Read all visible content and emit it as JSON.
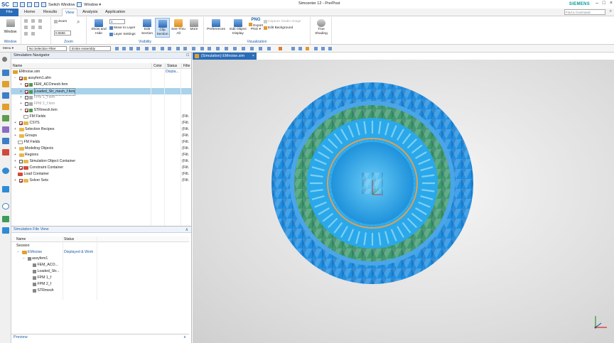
{
  "titlebar": {
    "logo": "SC",
    "switch_window": "Switch Window",
    "window_menu": "Window ▾",
    "title": "Simcenter 12 - Pre/Post",
    "brand": "SIEMENS"
  },
  "tabs": [
    {
      "label": "File"
    },
    {
      "label": "Home"
    },
    {
      "label": "Results"
    },
    {
      "label": "View"
    },
    {
      "label": "Analysis"
    },
    {
      "label": "Application"
    }
  ],
  "search_placeholder": "Find a Command",
  "ribbon": {
    "window_label": "Window",
    "zoom_label": "Zoom",
    "zoom_value": "0.5556",
    "visibility_label": "Visibility",
    "visualization_label": "Visualization",
    "layer_value": "1",
    "show_hide": "Show and Hide",
    "move_to_layer": "Move to Layer",
    "layer_settings": "Layer Settings",
    "edit_section": "Edit Section",
    "clip_section": "Clip Section",
    "see_thru_all": "See-Thru All",
    "more": "More",
    "preferences": "Preferences",
    "edit_object_display": "Edit Object Display",
    "export_png": "Export PNG ▾",
    "png": "PNG",
    "capture_studio_image": "Capture Studio Image",
    "edit_background": "Edit Background",
    "true_shading": "True Shading"
  },
  "toolbar": {
    "menu": "Menu ▾",
    "selection_filter": "No Selection Filter",
    "assembly_scope": "Entire Assembly"
  },
  "nav": {
    "title": "Simulation Navigator",
    "columns": [
      "Name",
      "Color",
      "Status",
      "Filte"
    ],
    "rows": [
      {
        "name": "EMnoise.sim",
        "status": "Displa...",
        "fi": ""
      },
      {
        "name": "assyfem1.afm",
        "status": "",
        "fi": ""
      },
      {
        "name": "FEM_ACOmesh.fem",
        "status": "",
        "fi": ""
      },
      {
        "name": "Loaded_Str_mesh_f.fem",
        "status": "",
        "fi": ""
      },
      {
        "name": "FPM 1_f.fem",
        "status": "",
        "fi": ""
      },
      {
        "name": "FPM 2_f.fem",
        "status": "",
        "fi": ""
      },
      {
        "name": "STRmesh.fem",
        "status": "",
        "fi": ""
      },
      {
        "name": "FM Fields",
        "status": "",
        "fi": "(Filt."
      },
      {
        "name": "CSYS",
        "status": "",
        "fi": "(Filt."
      },
      {
        "name": "Selection Recipes",
        "status": "",
        "fi": "(Filt."
      },
      {
        "name": "Groups",
        "status": "",
        "fi": "(Filt."
      },
      {
        "name": "FM Fields",
        "status": "",
        "fi": "(Filt."
      },
      {
        "name": "Modeling Objects",
        "status": "",
        "fi": "(Filt."
      },
      {
        "name": "Regions",
        "status": "",
        "fi": "(Filt."
      },
      {
        "name": "Simulation Object Container",
        "status": "",
        "fi": "(Filt."
      },
      {
        "name": "Constraint Container",
        "status": "",
        "fi": "(Filt."
      },
      {
        "name": "Load Container",
        "status": "",
        "fi": "(Filt."
      },
      {
        "name": "Solver Sets",
        "status": "",
        "fi": "(Filt."
      }
    ]
  },
  "fileview": {
    "title": "Simulation File View",
    "columns": [
      "Name",
      "Status"
    ],
    "rows": [
      {
        "name": "Session",
        "status": ""
      },
      {
        "name": "EMnoise",
        "status": "Displayed & Work"
      },
      {
        "name": "assyfem1",
        "status": ""
      },
      {
        "name": "FEM_ACO...",
        "status": ""
      },
      {
        "name": "Loaded_Str...",
        "status": ""
      },
      {
        "name": "FPM 1_f",
        "status": ""
      },
      {
        "name": "FPM 2_f",
        "status": ""
      },
      {
        "name": "STRmesh",
        "status": ""
      }
    ],
    "preview": "Preview"
  },
  "viewport": {
    "tab_label": "(Simulation) EMnoise.sim",
    "colors": {
      "outer_ring": "#1f8ee0",
      "green_ring": "#3f9a6e",
      "inner_blue": "#2aa8ea",
      "orange_ring": "#e2a050",
      "background": "#e3e3e3"
    }
  }
}
